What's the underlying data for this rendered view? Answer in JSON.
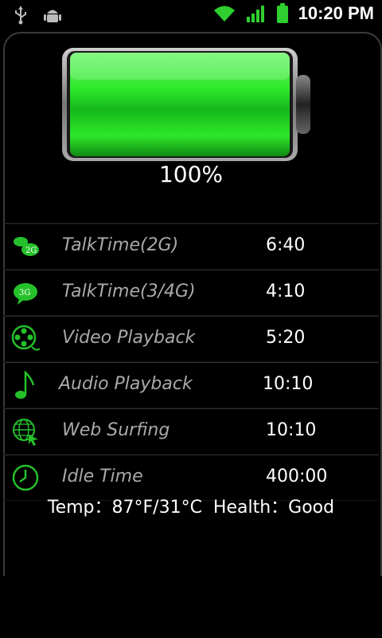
{
  "status_bar": {
    "time": "10:20 PM",
    "icons": [
      "usb-icon",
      "android-debug-icon",
      "wifi-icon",
      "signal-icon",
      "battery-icon"
    ]
  },
  "battery": {
    "percent_text": "100%",
    "level": 1.0,
    "fill_color": "#22e02e"
  },
  "rows": [
    {
      "icon": "talktime-2g-icon",
      "icon_text": "2G",
      "label": "TalkTime(2G)",
      "value": "6:40"
    },
    {
      "icon": "talktime-3g-icon",
      "icon_text": "3G",
      "label": "TalkTime(3/4G)",
      "value": "4:10"
    },
    {
      "icon": "video-reel-icon",
      "label": "Video Playback",
      "value": "5:20"
    },
    {
      "icon": "music-note-icon",
      "label": "Audio Playback",
      "value": "10:10"
    },
    {
      "icon": "globe-cursor-icon",
      "label": "Web Surfing",
      "value": "10:10"
    },
    {
      "icon": "clock-icon",
      "label": "Idle Time",
      "value": "400:00"
    }
  ],
  "footer": {
    "text": "Temp：87°F/31°C  Health：Good"
  },
  "colors": {
    "accent": "#22e02e",
    "label": "#a9a9a9",
    "background": "#000000"
  }
}
